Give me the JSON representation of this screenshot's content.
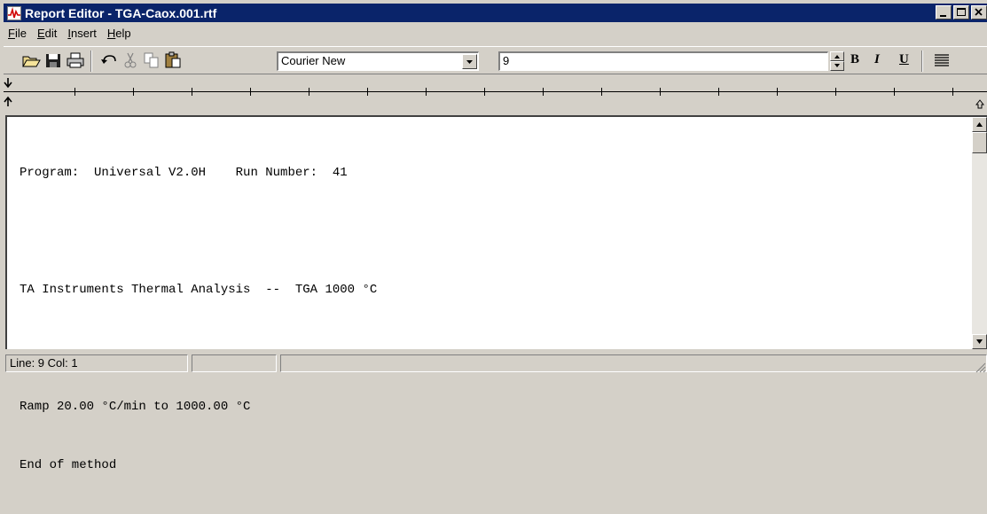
{
  "window": {
    "title": "Report Editor - TGA-Caox.001.rtf"
  },
  "menu": [
    {
      "label": "File",
      "mnemonic": "F",
      "rest": "ile"
    },
    {
      "label": "Edit",
      "mnemonic": "E",
      "rest": "dit"
    },
    {
      "label": "Insert",
      "mnemonic": "I",
      "rest": "nsert"
    },
    {
      "label": "Help",
      "mnemonic": "H",
      "rest": "elp"
    }
  ],
  "toolbar": {
    "font_name": "Courier New",
    "font_size": "9",
    "bold_label": "B",
    "italic_label": "I",
    "underline_label": "U",
    "icons": [
      "open-icon",
      "save-icon",
      "print-icon",
      "undo-icon",
      "cut-icon",
      "copy-icon",
      "paste-icon",
      "align-icon"
    ]
  },
  "document": {
    "lines": [
      "Program:  Universal V2.0H    Run Number:  41",
      "",
      "TA Instruments Thermal Analysis  --  TGA 1000 °C",
      "",
      "Ramp 20.00 °C/min to 1000.00 °C",
      "End of method"
    ]
  },
  "status": {
    "position": "Line:  9  Col:  1",
    "panel2": "",
    "panel3": ""
  },
  "colors": {
    "titlebar": "#0a246a",
    "chrome": "#d4d0c8"
  }
}
